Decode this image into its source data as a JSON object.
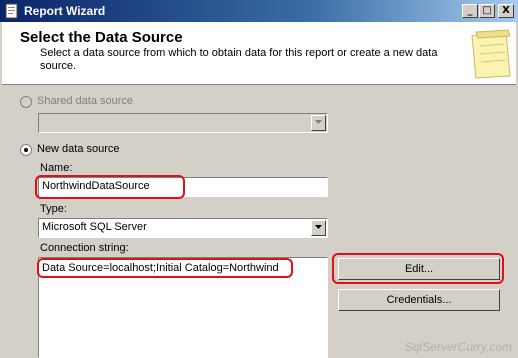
{
  "window": {
    "title": "Report Wizard",
    "minimize": "_",
    "maximize": "□",
    "close": "X"
  },
  "header": {
    "title": "Select the Data Source",
    "description": "Select a data source from which to obtain data for this report or create a new data source."
  },
  "shared": {
    "label": "Shared data source",
    "value": ""
  },
  "new_source": {
    "label": "New data source",
    "name_label": "Name:",
    "name_value": "NorthwindDataSource",
    "type_label": "Type:",
    "type_value": "Microsoft SQL Server",
    "connection_label": "Connection string:",
    "connection_value": "Data Source=localhost;Initial Catalog=Northwind"
  },
  "buttons": {
    "edit": "Edit...",
    "credentials": "Credentials..."
  },
  "watermark": "SqlServerCurry.com",
  "colors": {
    "highlight": "#e0101a",
    "title_bar": "#0a246a"
  }
}
